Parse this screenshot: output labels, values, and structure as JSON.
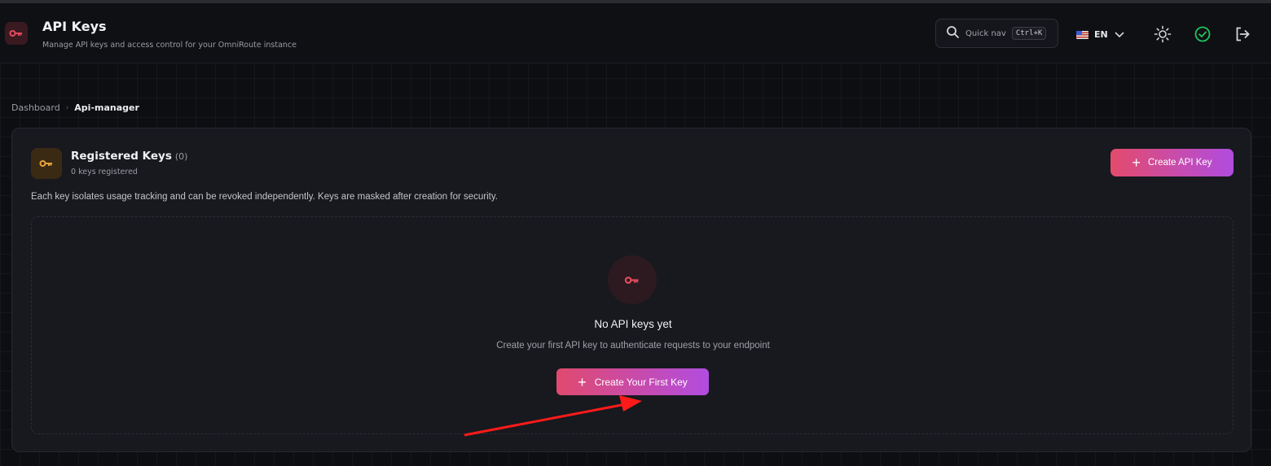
{
  "header": {
    "title": "API Keys",
    "subtitle": "Manage API keys and access control for your OmniRoute instance",
    "quick_nav": {
      "label": "Quick nav",
      "shortcut": "Ctrl+K"
    },
    "language": "EN"
  },
  "breadcrumb": {
    "parent": "Dashboard",
    "current": "Api-manager"
  },
  "card": {
    "title": "Registered Keys",
    "count": "(0)",
    "subtitle": "0 keys registered",
    "create_button": "Create API Key",
    "description": "Each key isolates usage tracking and can be revoked independently. Keys are masked after creation for security."
  },
  "empty_state": {
    "title": "No API keys yet",
    "subtitle": "Create your first API key to authenticate requests to your endpoint",
    "button": "Create Your First Key"
  },
  "colors": {
    "accent_start": "#e34b6c",
    "accent_end": "#b04ce0",
    "key_icon": "#e24a5e",
    "card_key_icon": "#e8a23a",
    "success": "#22c55e",
    "annotation_arrow": "#ff1a1a"
  },
  "icons": [
    "key-icon",
    "search-icon",
    "flag-us-icon",
    "chevron-down-icon",
    "sun-icon",
    "check-circle-icon",
    "logout-icon",
    "plus-icon"
  ]
}
